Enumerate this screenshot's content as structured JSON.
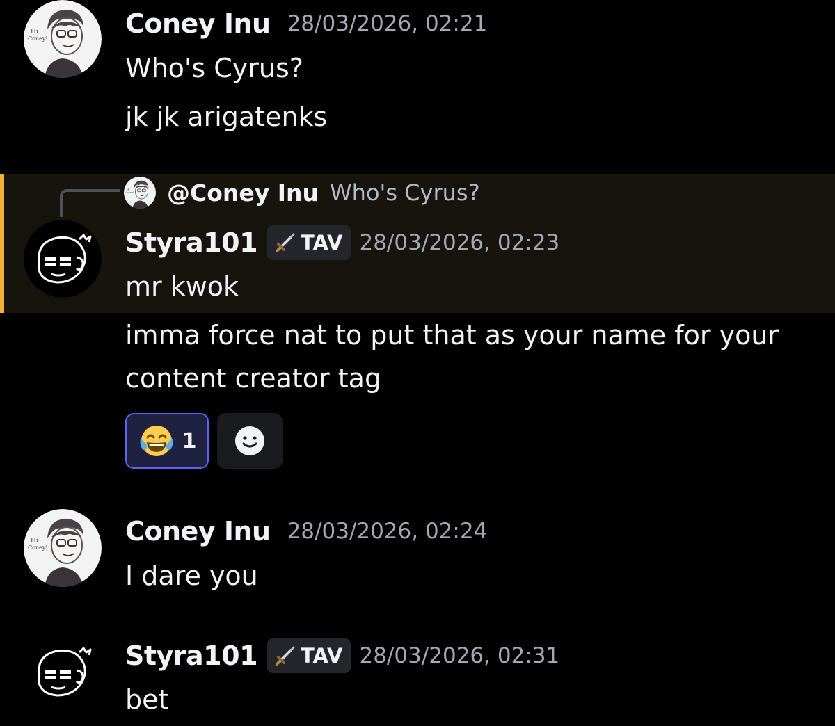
{
  "messages": [
    {
      "user": "Coney Inu",
      "timestamp": "28/03/2026, 02:21",
      "lines": [
        "Who's Cyrus?",
        "jk jk arigatenks"
      ]
    },
    {
      "reply_to": {
        "user": "@Coney Inu",
        "text": "Who's Cyrus?"
      },
      "user": "Styra101",
      "tag": "TAV",
      "timestamp": "28/03/2026, 02:23",
      "lines": [
        "mr kwok",
        "imma force nat to put that as your name for your",
        "content creator tag"
      ],
      "reaction": {
        "emoji": "face-with-tears-of-joy",
        "count": "1"
      }
    },
    {
      "user": "Coney Inu",
      "timestamp": "28/03/2026, 02:24",
      "lines": [
        "I dare you"
      ]
    },
    {
      "user": "Styra101",
      "tag": "TAV",
      "timestamp": "28/03/2026, 02:31",
      "lines": [
        "bet"
      ]
    }
  ],
  "colors": {
    "background": "#000000",
    "highlight": "#16140d",
    "highlight_bar": "#f0b232",
    "reaction_border": "#5865f2",
    "timestamp": "#a5a8b0"
  }
}
